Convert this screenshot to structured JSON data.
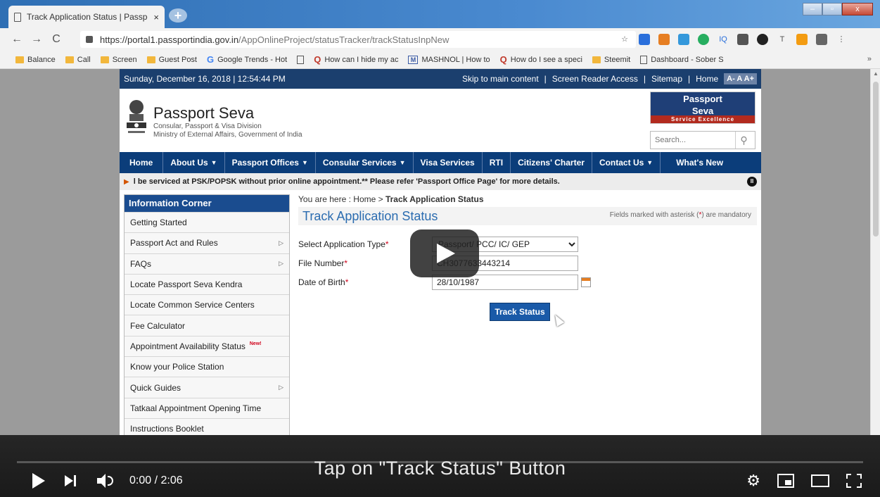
{
  "browser": {
    "tab_title": "Track Application Status | Passpo",
    "tab_close": "×",
    "new_tab": "+",
    "url_host": "https://portal1.passportindia.gov.in",
    "url_path": "/AppOnlineProject/statusTracker/trackStatusInpNew",
    "nav": {
      "back": "←",
      "forward": "→",
      "reload": "C"
    },
    "bookmarks": [
      {
        "label": "Balance",
        "icon": "folder-icon"
      },
      {
        "label": "Call",
        "icon": "folder-icon"
      },
      {
        "label": "Screen",
        "icon": "folder-icon"
      },
      {
        "label": "Guest Post",
        "icon": "folder-icon"
      },
      {
        "label": "Google Trends - Hot",
        "icon": "google-icon"
      },
      {
        "label": "",
        "icon": "page-icon"
      },
      {
        "label": "How can I hide my ac",
        "icon": "quora-icon"
      },
      {
        "label": "MASHNOL | How to",
        "icon": "m-icon"
      },
      {
        "label": "How do I see a speci",
        "icon": "quora-icon"
      },
      {
        "label": "Steemit",
        "icon": "folder-icon"
      },
      {
        "label": "Dashboard - Sober S",
        "icon": "page-icon"
      }
    ],
    "bookmarks_more": "»"
  },
  "site": {
    "datetime": "Sunday, December 16, 2018 | 12:54:44 PM",
    "top_links": [
      "Skip to main content",
      "Screen Reader Access",
      "Sitemap",
      "Home"
    ],
    "font_sizes": [
      "A-",
      "A",
      "A+"
    ],
    "brand_name": "Passport Seva",
    "brand_sub1": "Consular, Passport & Visa Division",
    "brand_sub2": "Ministry of External Affairs, Government of India",
    "logo_text1": "Passport",
    "logo_text2": "Seva",
    "logo_tagline": "Service Excellence",
    "search_placeholder": "Search...",
    "nav": [
      {
        "label": "Home",
        "caret": ""
      },
      {
        "label": "About Us",
        "caret": "▼"
      },
      {
        "label": "Passport Offices",
        "caret": "▼"
      },
      {
        "label": "Consular Services",
        "caret": "▼"
      },
      {
        "label": "Visa Services",
        "caret": ""
      },
      {
        "label": "RTI",
        "caret": ""
      },
      {
        "label": "Citizens' Charter",
        "caret": ""
      },
      {
        "label": "Contact Us",
        "caret": "▼"
      },
      {
        "label": "What's New",
        "caret": ""
      }
    ],
    "ticker": "l be serviced at PSK/POPSK without prior online appointment.** Please refer 'Passport Office Page' for more details.",
    "info_corner": {
      "title": "Information Corner",
      "items": [
        {
          "label": "Getting Started",
          "arrow": "",
          "new": ""
        },
        {
          "label": "Passport Act and Rules",
          "arrow": "▷",
          "new": ""
        },
        {
          "label": "FAQs",
          "arrow": "▷",
          "new": ""
        },
        {
          "label": "Locate Passport Seva Kendra",
          "arrow": "",
          "new": ""
        },
        {
          "label": "Locate Common Service Centers",
          "arrow": "",
          "new": ""
        },
        {
          "label": "Fee Calculator",
          "arrow": "",
          "new": ""
        },
        {
          "label": "Appointment Availability Status",
          "arrow": "",
          "new": "New!"
        },
        {
          "label": "Know your Police Station",
          "arrow": "",
          "new": ""
        },
        {
          "label": "Quick Guides",
          "arrow": "▷",
          "new": ""
        },
        {
          "label": "Tatkaal Appointment Opening Time",
          "arrow": "",
          "new": ""
        },
        {
          "label": "Instructions Booklet",
          "arrow": "",
          "new": ""
        }
      ]
    },
    "breadcrumb_prefix": "You are here : Home > ",
    "breadcrumb_current": "Track Application Status",
    "page_title": "Track Application Status",
    "mandatory_note_a": "Fields marked with asterisk (",
    "mandatory_star": "*",
    "mandatory_note_b": ") are mandatory",
    "form": {
      "type_label": "Select Application Type",
      "type_value": "Passport/ PCC/ IC/ GEP",
      "file_label": "File Number",
      "file_value": "CH3077633443214",
      "dob_label": "Date of Birth",
      "dob_value": "28/10/1987",
      "submit_label": "Track Status"
    }
  },
  "player": {
    "caption": "Tap on \"Track Status\" Button",
    "time": "0:00 / 2:06",
    "progress": 0
  }
}
